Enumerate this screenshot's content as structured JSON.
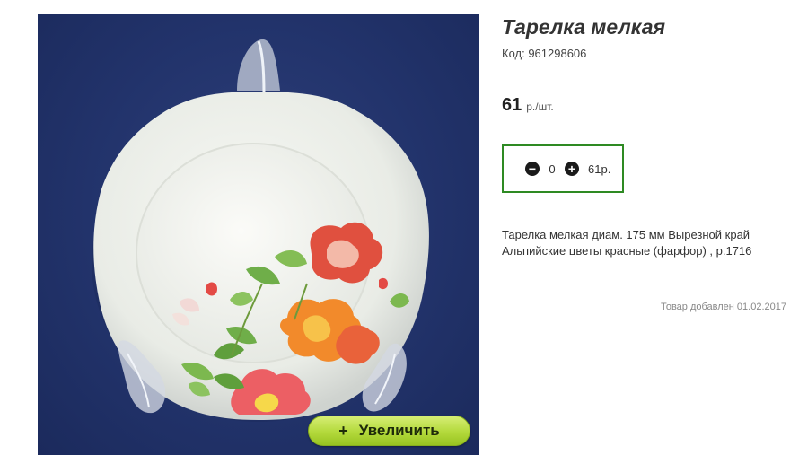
{
  "product": {
    "title": "Тарелка мелкая",
    "code": "Код: 961298606",
    "price_value": "61",
    "price_unit": "р./шт.",
    "quantity": "0",
    "total": "61р.",
    "description": "Тарелка мелкая диам. 175 мм Вырезной край Альпийские цветы красные (фарфор) , р.1716",
    "added_date": "Товар добавлен 01.02.2017"
  },
  "gallery": {
    "zoom_icon": "+",
    "zoom_label": "Увеличить"
  },
  "icons": {
    "decrease": "minus-circle-icon",
    "increase": "plus-circle-icon"
  },
  "colors": {
    "zoom_button": "#b3d93b",
    "qty_border": "#2e8a23",
    "photo_background": "#22336b"
  }
}
